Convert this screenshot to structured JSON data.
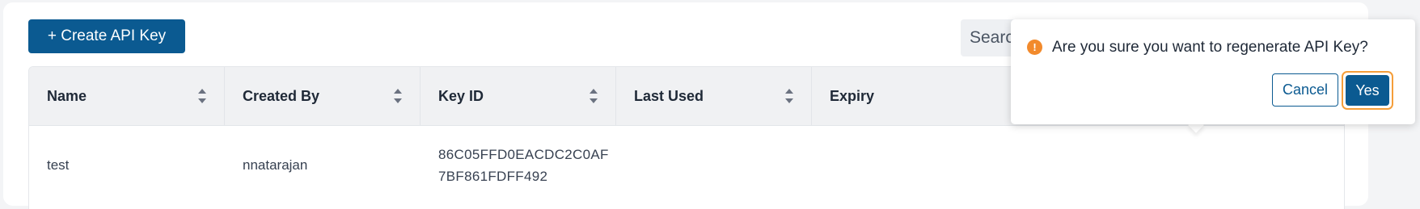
{
  "toolbar": {
    "create_label": "+ Create API Key",
    "search_placeholder": "Search..."
  },
  "table": {
    "headers": {
      "name": "Name",
      "created_by": "Created By",
      "key_id": "Key ID",
      "last_used": "Last Used",
      "expiry": "Expiry"
    },
    "rows": [
      {
        "name": "test",
        "created_by": "nnatarajan",
        "key_id_line1": "86C05FFD0EACDC2C0AF",
        "key_id_line2": "7BF861FDFF492",
        "last_used": "",
        "expiry": "",
        "enabled": true
      }
    ]
  },
  "popconfirm": {
    "icon": "exclamation-icon",
    "warning_glyph": "!",
    "message": "Are you sure you want to regenerate API Key?",
    "cancel_label": "Cancel",
    "confirm_label": "Yes"
  },
  "colors": {
    "primary": "#0b5a91",
    "focus_ring": "#f59e3a",
    "warning": "#f28a2c"
  }
}
